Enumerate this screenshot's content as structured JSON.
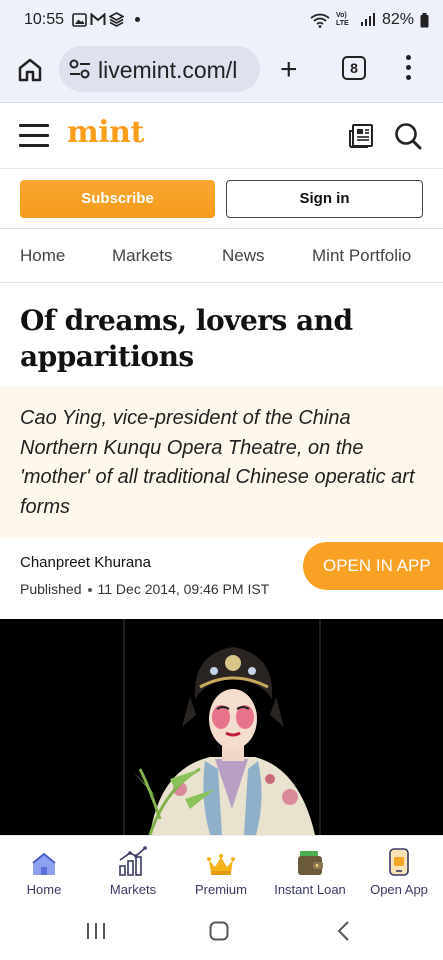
{
  "status_bar": {
    "time": "10:55",
    "battery": "82%",
    "lte_label": "Vo) LTE"
  },
  "browser": {
    "url": "livemint.com/l",
    "tab_count": "8"
  },
  "site": {
    "logo": "mint"
  },
  "auth": {
    "subscribe_label": "Subscribe",
    "signin_label": "Sign in"
  },
  "nav": {
    "items": [
      "Home",
      "Markets",
      "News",
      "Mint Portfolio"
    ]
  },
  "article": {
    "headline": "Of dreams, lovers and apparitions",
    "summary": "Cao Ying, vice-president of the China Northern Kunqu Opera Theatre, on the 'mother' of all traditional Chinese operatic art forms",
    "author": "Chanpreet Khurana",
    "published_label": "Published",
    "published_date": "11 Dec 2014, 09:46 PM IST",
    "open_in_app_label": "OPEN IN APP"
  },
  "bottom_nav": {
    "items": [
      {
        "label": "Home",
        "icon": "home-icon"
      },
      {
        "label": "Markets",
        "icon": "markets-chart-icon"
      },
      {
        "label": "Premium",
        "icon": "crown-icon"
      },
      {
        "label": "Instant Loan",
        "icon": "wallet-icon"
      },
      {
        "label": "Open App",
        "icon": "phone-app-icon"
      }
    ]
  },
  "colors": {
    "brand": "#f99d1c",
    "summary_bg": "#fdf8eb",
    "chrome_bg": "#eef0fa",
    "bottom_nav_text": "#3a3a66"
  }
}
